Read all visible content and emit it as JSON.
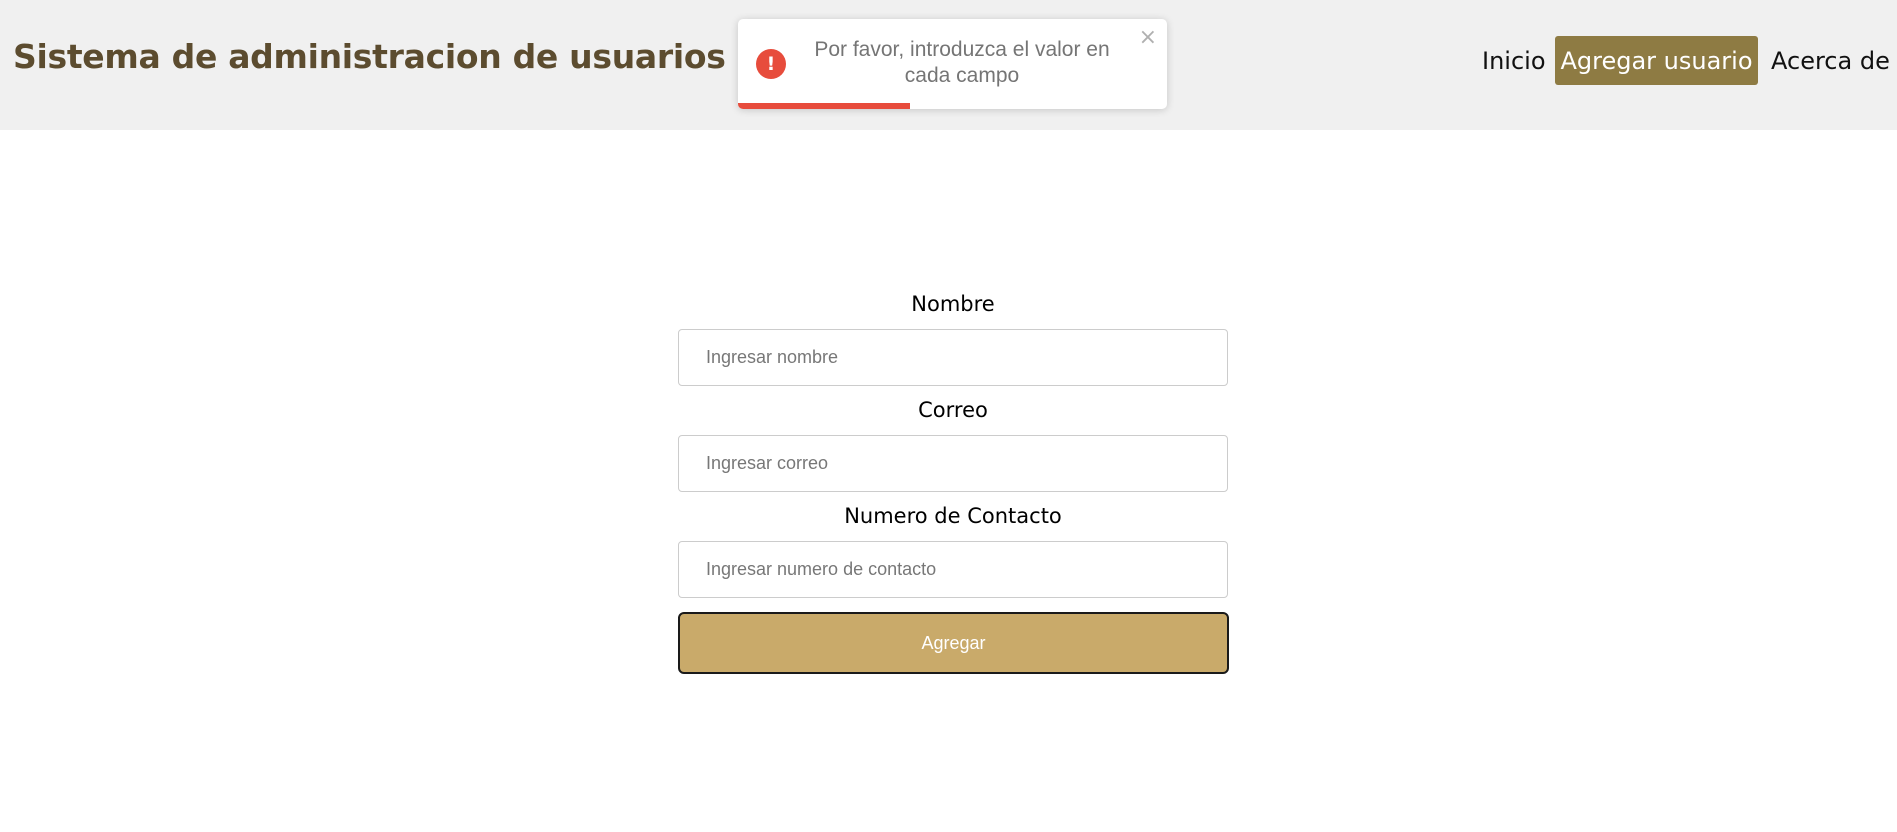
{
  "header": {
    "brand": "Sistema de administracion de usuarios",
    "background_color": "#f0f0f0",
    "brand_color": "#5c4c2f"
  },
  "nav": {
    "items": [
      {
        "label": "Inicio",
        "active": false
      },
      {
        "label": "Agregar usuario",
        "active": true
      },
      {
        "label": "Acerca de",
        "active": false
      }
    ],
    "active_color": "#8e7b43"
  },
  "toast": {
    "type": "error",
    "icon": "error-exclamation-icon",
    "icon_glyph": "!",
    "message": "Por favor, introduzca el valor en cada campo",
    "close_glyph": "×",
    "progress": 0.4,
    "color": "#e74c3c"
  },
  "form": {
    "fields": [
      {
        "label": "Nombre",
        "value": "",
        "placeholder": "Ingresar nombre"
      },
      {
        "label": "Correo",
        "value": "",
        "placeholder": "Ingresar correo"
      },
      {
        "label": "Numero de Contacto",
        "value": "",
        "placeholder": "Ingresar numero de contacto"
      }
    ],
    "submit_label": "Agregar",
    "submit_color": "#c9aa6a"
  }
}
